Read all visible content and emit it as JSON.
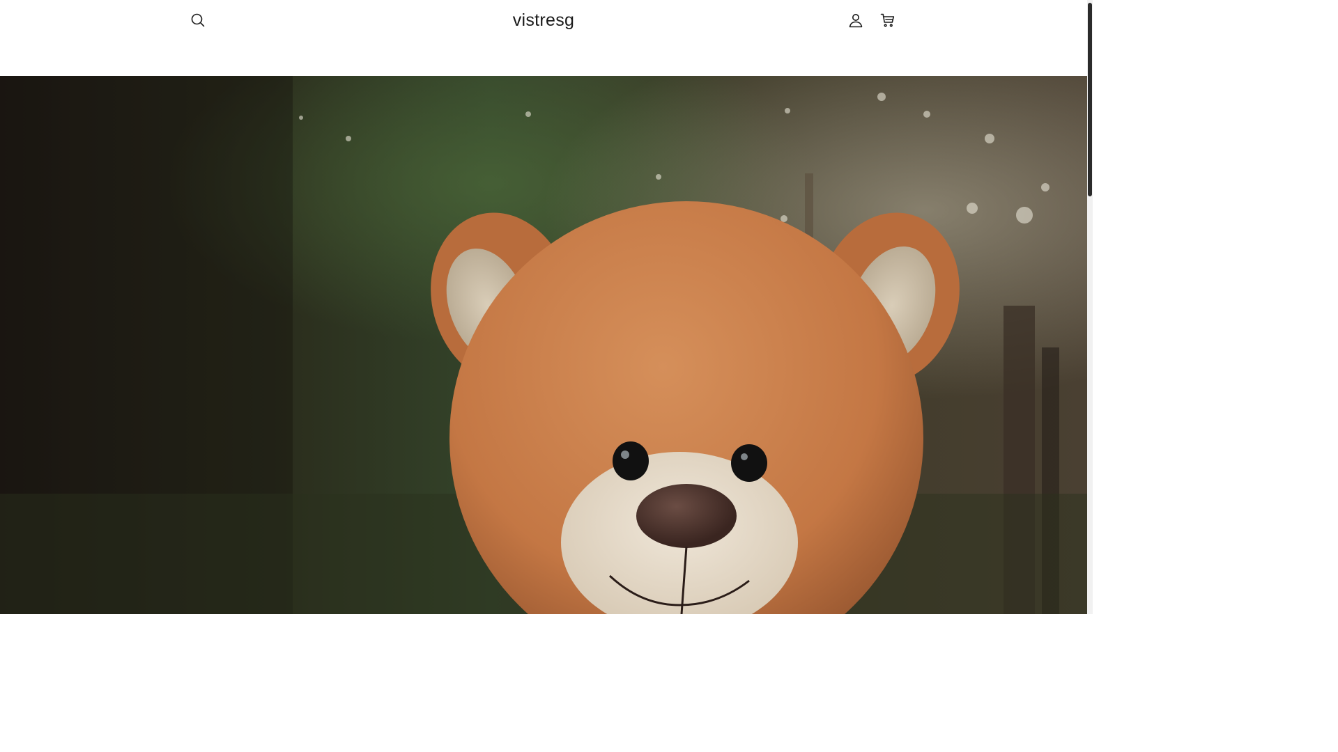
{
  "header": {
    "store_name": "vistresg",
    "icons": {
      "search": "search-icon",
      "account": "account-icon",
      "cart": "cart-icon"
    }
  },
  "hero": {
    "image": "teddy-bear-in-forest"
  },
  "colors": {
    "header_bg": "#ffffff",
    "text": "#1a1a1a",
    "scrollbar_thumb": "#2b2b2b"
  }
}
